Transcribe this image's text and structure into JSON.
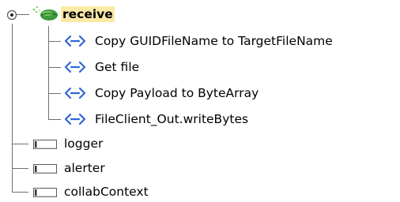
{
  "tree": {
    "root": {
      "label": "receive",
      "icon": "operation-leaf-icon",
      "expander": "expanded-node-toggle-icon",
      "selected": true,
      "children": [
        {
          "label": "Copy GUIDFileName to TargetFileName",
          "icon": "mapping-arrow-icon"
        },
        {
          "label": "Get file",
          "icon": "mapping-arrow-icon"
        },
        {
          "label": "Copy Payload to ByteArray",
          "icon": "mapping-arrow-icon"
        },
        {
          "label": "FileClient_Out.writeBytes",
          "icon": "mapping-arrow-icon"
        }
      ]
    },
    "fields": [
      {
        "label": "logger",
        "icon": "field-box-icon"
      },
      {
        "label": "alerter",
        "icon": "field-box-icon"
      },
      {
        "label": "collabContext",
        "icon": "field-box-icon"
      }
    ]
  },
  "colors": {
    "selection_highlight": "#fbe9a6",
    "arrow_icon": "#2f66d8",
    "leaf_green": "#2f8f2f",
    "tree_lines": "#707070"
  }
}
